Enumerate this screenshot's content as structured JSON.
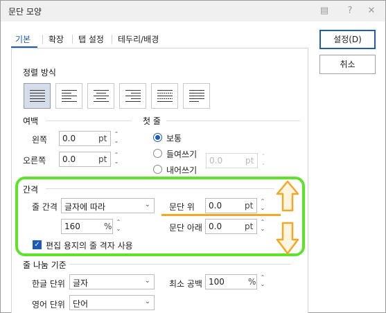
{
  "window": {
    "title": "문단 모양"
  },
  "tabs": [
    {
      "label": "기본",
      "active": true
    },
    {
      "label": "확장"
    },
    {
      "label": "탭 설정"
    },
    {
      "label": "테두리/배경"
    }
  ],
  "buttons": {
    "ok": "설정(D)",
    "cancel": "취소"
  },
  "alignment": {
    "title": "정렬 방식",
    "options": [
      "justify",
      "left",
      "center",
      "right",
      "distribute",
      "divide"
    ],
    "selected": "justify"
  },
  "margin": {
    "title": "여백",
    "left": {
      "label": "왼쪽",
      "value": "0.0",
      "unit": "pt"
    },
    "right": {
      "label": "오른쪽",
      "value": "0.0",
      "unit": "pt"
    }
  },
  "first_line": {
    "title": "첫 줄",
    "options": [
      "보통",
      "들여쓰기",
      "내어쓰기"
    ],
    "selected": "보통",
    "value": "0.0",
    "unit": "pt"
  },
  "spacing": {
    "title": "간격",
    "line_spacing": {
      "label": "줄 간격",
      "type": "글자에 따라",
      "value": "160",
      "unit": "%"
    },
    "para_above": {
      "label": "문단 위",
      "value": "0.0",
      "unit": "pt"
    },
    "para_below": {
      "label": "문단 아래",
      "value": "0.0",
      "unit": "pt"
    },
    "grid_checkbox": {
      "label": "편집 용지의 줄 격자 사용",
      "checked": true
    }
  },
  "line_break": {
    "title": "줄 나눔 기준",
    "korean": {
      "label": "한글 단위",
      "value": "글자"
    },
    "english": {
      "label": "영어 단위",
      "value": "단어"
    },
    "min_space": {
      "label": "최소 공백",
      "value": "100",
      "unit": "%"
    }
  },
  "colors": {
    "accent": "#1e5bb8",
    "highlight_box": "#5ee32a",
    "highlight_arrow": "#f5a623"
  }
}
